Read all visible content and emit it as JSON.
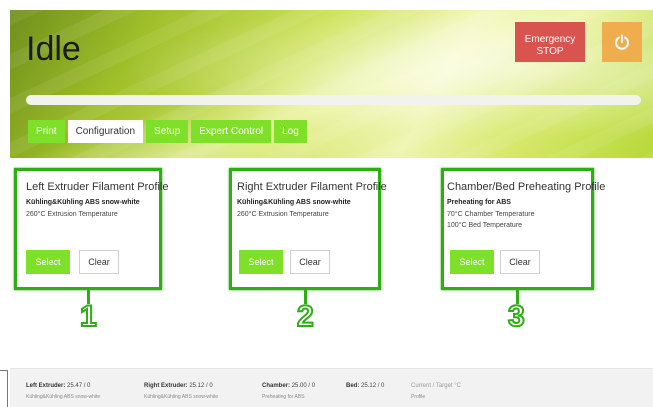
{
  "header": {
    "title": "Idle",
    "emergency_stop": "Emergency\nSTOP",
    "power_icon": "power-icon",
    "progress": 0
  },
  "tabs": [
    {
      "label": "Print",
      "active": false
    },
    {
      "label": "Configuration",
      "active": true
    },
    {
      "label": "Setup",
      "active": false
    },
    {
      "label": "Expert Control",
      "active": false
    },
    {
      "label": "Log",
      "active": false
    }
  ],
  "cards": [
    {
      "title": "Left Extruder Filament Profile",
      "subtitle": "Kühling&Kühling ABS snow-white",
      "lines": [
        "260°C Extrusion Temperature"
      ],
      "select": "Select",
      "clear": "Clear",
      "marker": "1"
    },
    {
      "title": "Right Extruder Filament Profile",
      "subtitle": "Kühling&Kühling ABS snow-white",
      "lines": [
        "260°C Extrusion Temperature"
      ],
      "select": "Select",
      "clear": "Clear",
      "marker": "2"
    },
    {
      "title": "Chamber/Bed Preheating Profile",
      "subtitle": "Preheating for ABS",
      "lines": [
        "70°C Chamber Temperature",
        "100°C Bed Temperature"
      ],
      "select": "Select",
      "clear": "Clear",
      "marker": "3"
    }
  ],
  "status": {
    "left_extruder": {
      "label": "Left Extruder:",
      "value": "25.47 / 0",
      "profile": "Kühling&Kühling ABS snow-white"
    },
    "right_extruder": {
      "label": "Right Extruder:",
      "value": "25.12 / 0",
      "profile": "Kühling&Kühling ABS snow-white"
    },
    "chamber": {
      "label": "Chamber:",
      "value": "25.00 / 0",
      "profile": "Preheating for ABS"
    },
    "bed": {
      "label": "Bed:",
      "value": "25.12 / 0"
    },
    "legend": {
      "label": "Current / Target °C",
      "sub": "Profile"
    }
  },
  "colors": {
    "accent_green": "#7fe02a",
    "highlight_green": "#2fad14",
    "emergency_red": "#d9534f",
    "power_orange": "#f0ad4e"
  }
}
